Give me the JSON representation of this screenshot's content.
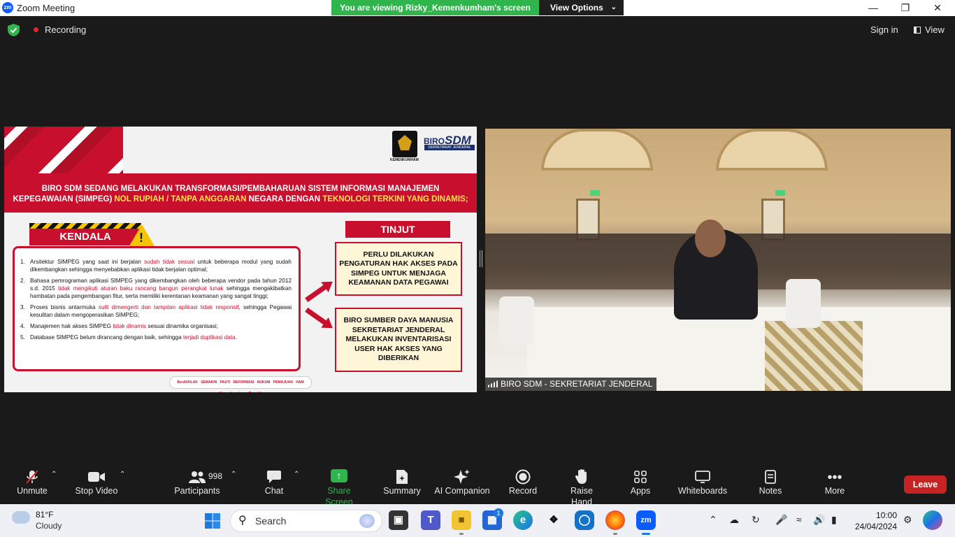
{
  "titlebar": {
    "app_icon": "zm",
    "title": "Zoom Meeting",
    "viewing_banner": "You are viewing Rizky_Kemenkumham's screen",
    "view_options": "View Options",
    "minimize": "—",
    "restore": "❐",
    "close": "✕"
  },
  "meeting_bar": {
    "recording": "Recording",
    "sign_in": "Sign in",
    "view": "View"
  },
  "slide": {
    "logo_caption": "KEMENKUMHAM",
    "biro": "BIRO",
    "sdm": "SDM",
    "biro_sub": "SEKRETARIAT JENDERAL",
    "banner_line1": "BIRO SDM SEDANG MELAKUKAN TRANSFORMASI/PEMBAHARUAN  SISTEM INFORMASI MANAJEMEN",
    "banner_line2_a": "KEPEGAWAIAN (SIMPEG) ",
    "banner_line2_b": "NOL RUPIAH / TANPA ANGGARAN",
    "banner_line2_c": " NEGARA DENGAN ",
    "banner_line2_d": "TEKNOLOGI TERKINI YANG DINAMIS;",
    "kendala": "KENDALA",
    "tinjut": "TINJUT",
    "items": [
      {
        "n": "1.",
        "a": "Arsitektur SIMPEG yang saat ini berjalan ",
        "r": "sudah tidak sesuai",
        "b": " untuk beberapa modul yang sudah dikembangkan sehingga menyebabkan aplikasi tidak berjalan optimal;"
      },
      {
        "n": "2.",
        "a": "Bahasa pemrograman aplikasi SIMPEG yang dikembangkan oleh beberapa vendor pada tahun 2012 s.d. 2015 ",
        "r": "tidak mengikuti aturan baku rancang bangun perangkat lunak",
        "b": " sehingga mengakibatkan hambatan pada pengembangan fitur, serta memiliki kerentanan keamanan yang sangat tinggi;"
      },
      {
        "n": "3.",
        "a": "Proses bisnis antarmuka ",
        "r": "sulit dimengerti dan tampilan aplikasi tidak responsif",
        "b": ", sehingga Pegawai kesulitan dalam mengoperasikan SIMPEG;"
      },
      {
        "n": "4.",
        "a": "Manajemen hak akses SIMPEG ",
        "r": "tidak dinamis",
        "b": " sesuai dinamika organisasi;"
      },
      {
        "n": "5.",
        "a": "Database SIMPEG belum dirancang dengan baik, sehingga ",
        "r": "terjadi duplikasi data",
        "b": "."
      }
    ],
    "tinjut_box1": "PERLU DILAKUKAN PENGATURAN HAK AKSES PADA SIMPEG UNTUK MENJAGA KEAMANAN DATA PEGAWAI",
    "tinjut_box2": "BIRO SUMBER DAYA MANUSIA SEKRETARIAT JENDERAL MELAKUKAN INVENTARISASI USER HAK AKSES YANG DIBERIKAN",
    "footer_logos": "BerAKHLAK SEMAKIN PASTI REFORMASI HUKUM PEMAJUAN HAM Kemenkumham Bangkit"
  },
  "video": {
    "participant": "BIRO SDM - SEKRETARIAT JENDERAL"
  },
  "toolbar": {
    "unmute": "Unmute",
    "stop_video": "Stop Video",
    "participants": "Participants",
    "participants_count": "998",
    "chat": "Chat",
    "share_screen": "Share Screen",
    "summary": "Summary",
    "ai_companion": "AI Companion",
    "record": "Record",
    "raise_hand": "Raise Hand",
    "apps": "Apps",
    "whiteboards": "Whiteboards",
    "notes": "Notes",
    "more": "More",
    "leave": "Leave"
  },
  "taskbar": {
    "temperature": "81°F",
    "condition": "Cloudy",
    "search_placeholder": "Search",
    "teams_badge": "1",
    "time": "10:00",
    "date": "24/04/2024"
  },
  "colors": {
    "zoom_blue": "#0b5cff",
    "share_green": "#2fb54b",
    "leave_red": "#c82323",
    "slide_red": "#c8102e"
  }
}
